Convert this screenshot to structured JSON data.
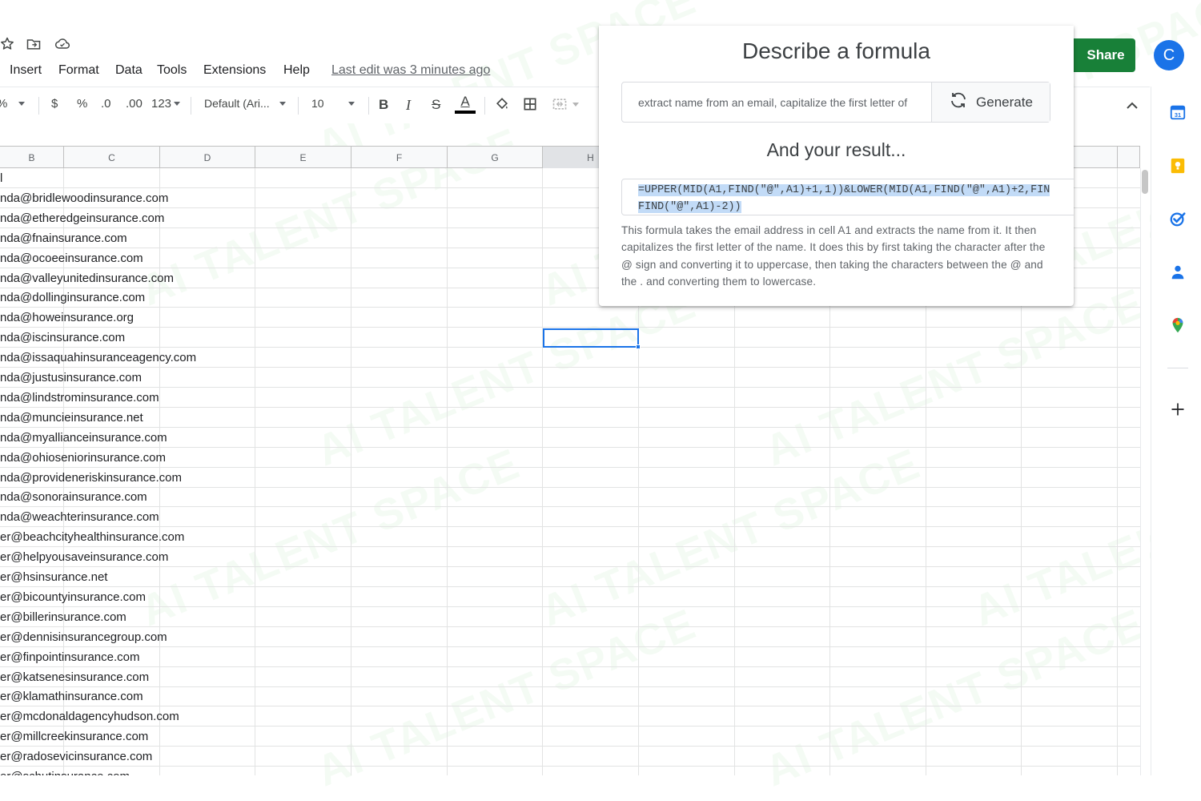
{
  "menubar": {
    "items": [
      "Insert",
      "Format",
      "Data",
      "Tools",
      "Extensions",
      "Help"
    ],
    "last_edit": "Last edit was 3 minutes ago"
  },
  "header": {
    "share_label": "Share",
    "avatar_letter": "C",
    "share_color": "#188038",
    "avatar_color": "#1a73e8"
  },
  "toolbar": {
    "zoom": "%",
    "currency": "$",
    "percent": "%",
    "decrease_decimals": ".0",
    "increase_decimals": ".00",
    "more_formats": "123",
    "font": "Default (Ari...",
    "font_size": "10",
    "bold": "B",
    "italic": "I",
    "strikethrough": "S",
    "text_color_letter": "A"
  },
  "grid": {
    "columns": [
      "B",
      "C",
      "D",
      "E",
      "F",
      "G",
      "H",
      "",
      "",
      "",
      "",
      "",
      ""
    ],
    "active_column": "H",
    "rows": [
      "l",
      "nda@bridlewoodinsurance.com",
      "nda@etheredgeinsurance.com",
      "nda@fnainsurance.com",
      "nda@ocoeeinsurance.com",
      "nda@valleyunitedinsurance.com",
      "nda@dollinginsurance.com",
      "nda@howeinsurance.org",
      "nda@iscinsurance.com",
      "nda@issaquahinsuranceagency.com",
      "nda@justusinsurance.com",
      "nda@lindstrominsurance.com",
      "nda@muncieinsurance.net",
      "nda@myallianceinsurance.com",
      "nda@ohioseniorinsurance.com",
      "nda@provideneriskinsurance.com",
      "nda@sonorainsurance.com",
      "nda@weachterinsurance.com",
      "er@beachcityhealthinsurance.com",
      "er@helpyousaveinsurance.com",
      "er@hsinsurance.net",
      "er@bicountyinsurance.com",
      "er@billerinsurance.com",
      "er@dennisinsurancegroup.com",
      "er@finpointinsurance.com",
      "er@katsenesinsurance.com",
      "er@klamathinsurance.com",
      "er@mcdonaldagencyhudson.com",
      "er@millcreekinsurance.com",
      "er@radosevicinsurance.com",
      "er@schutinsurance.com"
    ]
  },
  "popup": {
    "title": "Describe a formula",
    "prompt_value": "extract name from an email, capitalize the first letter of",
    "generate_label": "Generate",
    "result_title": "And your result...",
    "formula_line1": "=UPPER(MID(A1,FIND(\"@\",A1)+1,1))&LOWER(MID(A1,FIND(\"@\",A1)+2,FIN",
    "formula_line2": "FIND(\"@\",A1)-2))",
    "description": "This formula takes the email address in cell A1 and extracts the name from it. It then capitalizes the first letter of the name. It does this by first taking the character after the @ sign and converting it to uppercase, then taking the characters between the @ and the . and converting them to lowercase."
  },
  "watermark": "AI TALENT SPACE"
}
